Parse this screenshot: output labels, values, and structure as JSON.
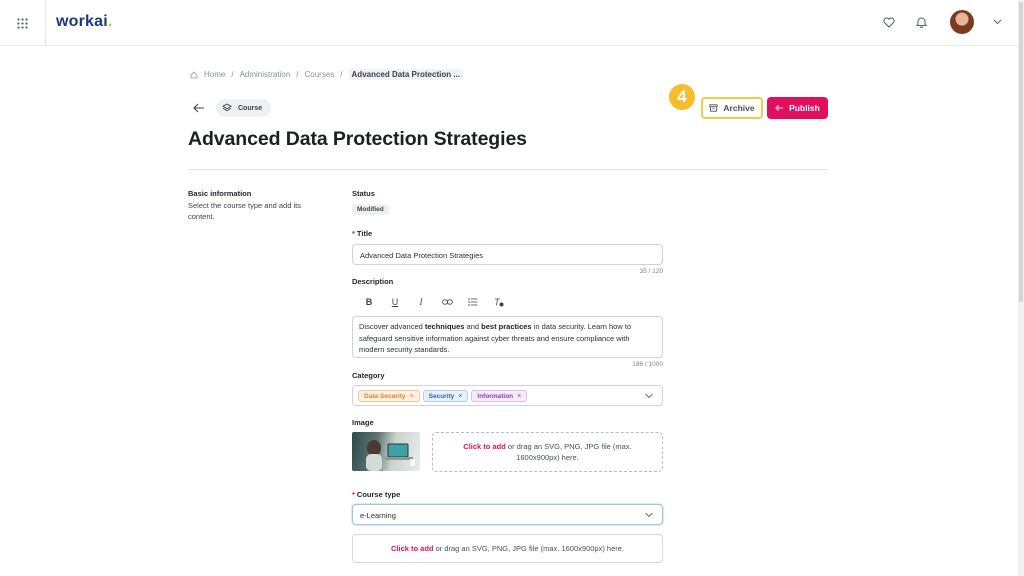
{
  "header": {
    "logo_text": "workai",
    "logo_dot": ".",
    "icons": [
      "apps-grid-icon",
      "heart-icon",
      "bell-icon",
      "chevron-down-icon"
    ]
  },
  "breadcrumb": {
    "items": [
      "Home",
      "Administration",
      "Courses"
    ],
    "separator": "/",
    "current": "Advanced Data Protection ..."
  },
  "page": {
    "chip_label": "Course",
    "title": "Advanced Data Protection Strategies",
    "step_number": "4",
    "archive_label": "Archive",
    "publish_label": "Publish"
  },
  "section": {
    "title": "Basic information",
    "description": "Select the course type and add its content."
  },
  "form": {
    "status_label": "Status",
    "status_value": "Modified",
    "title_label": "Title",
    "title_value": "Advanced Data Protection Strategies",
    "title_counter": "35 / 120",
    "description_label": "Description",
    "description_parts": {
      "p1": "Discover advanced ",
      "b1": "techniques",
      "p2": " and ",
      "b2": "best practices",
      "p3": " in data security. Learn how to safeguard sensitive information against cyber threats and ensure compliance with modern security standards."
    },
    "description_counter": "186 / 1000",
    "toolbar": {
      "bold": "B",
      "underline": "U",
      "italic": "I"
    },
    "category_label": "Category",
    "categories": [
      {
        "label": "Data Security",
        "color": "#e8801a",
        "bg": "#fdf0e4",
        "border": "#f4c79b"
      },
      {
        "label": "Security",
        "color": "#2d62b8",
        "bg": "#e8f0fb",
        "border": "#b7cdee"
      },
      {
        "label": "Information",
        "color": "#8a3fb0",
        "bg": "#f5ebfa",
        "border": "#dcc0ea"
      }
    ],
    "image_label": "Image",
    "image_drop_click": "Click to add",
    "image_drop_rest": " or drag an SVG, PNG, JPG file (max. 1600x900px) here.",
    "course_type_label": "Course type",
    "course_type_value": "e-Learning",
    "file_drop_click": "Click to add",
    "file_drop_rest": " or drag an SVG, PNG, JPG file (max. 1600x900px) here."
  },
  "colors": {
    "accent": "#e1105e",
    "highlight": "#f7c948",
    "brand": "#1b3a78"
  }
}
